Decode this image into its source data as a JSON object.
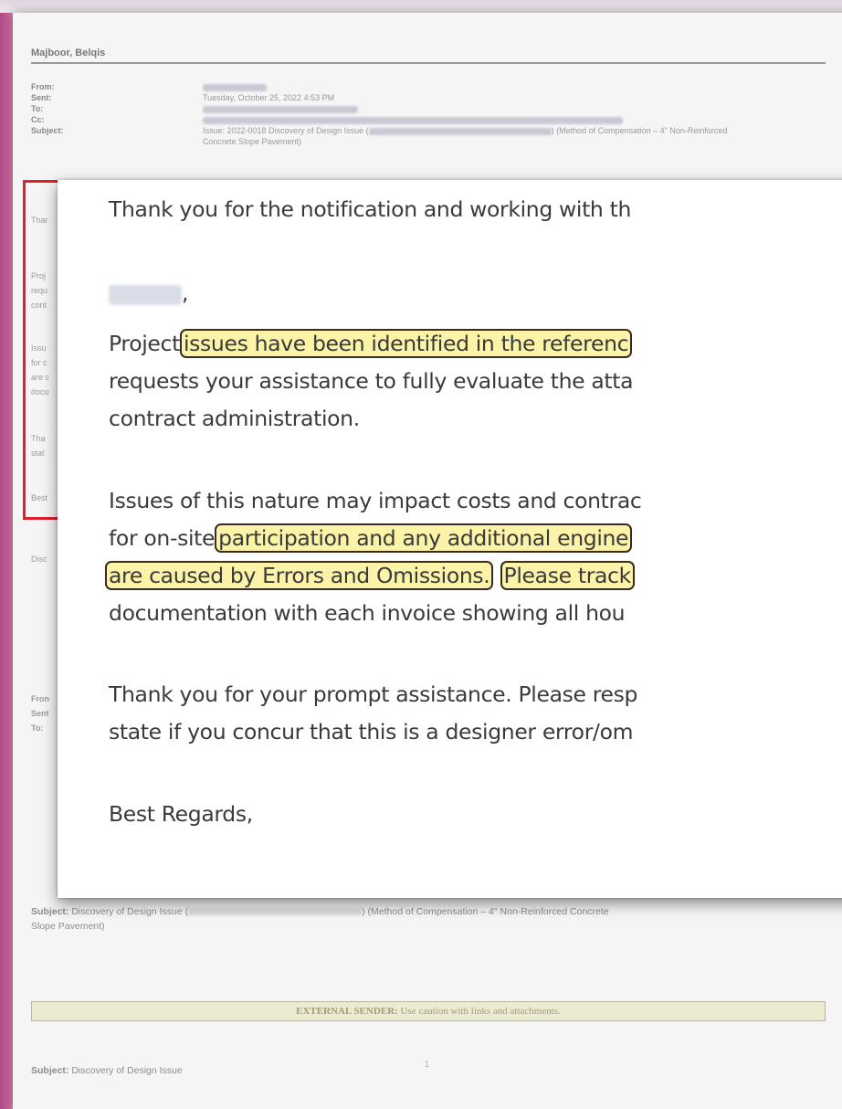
{
  "doc": {
    "author_name": "Majboor, Belqis",
    "header_labels": [
      "From:",
      "Sent:",
      "To:",
      "Cc:",
      "Subject:"
    ],
    "sent_value": "Tuesday, October 25, 2022 4:53 PM",
    "subject_value_part1": "Issue: 2022-0018 Discovery of Design Issue (",
    "subject_value_part2": ") (Method of Compensation – 4\" Non-Reinforced",
    "subject_value_line2": "Concrete Slope Pavement)",
    "left_peek": [
      "Thar",
      "Proj",
      "requ",
      "cont",
      "Issu",
      "for c",
      "are c",
      "docu",
      "Tha",
      "stat",
      "Best",
      "Disc",
      "Fron",
      "Sent",
      "To:"
    ],
    "lower_subject_label": "Subject:",
    "lower_subject_part1": "Discovery of Design Issue (",
    "lower_subject_part2": ") (Method of Compensation – 4\" Non-Reinforced Concrete",
    "lower_subject_line2": "Slope Pavement)",
    "external_label": "EXTERNAL SENDER:",
    "external_text": "Use caution with links and attachments.",
    "bottom_subject_label": "Subject:",
    "bottom_subject_value": "Discovery of Design Issue",
    "page_number": "1"
  },
  "callout": {
    "line1": "Thank you for the notification and working with th",
    "greeting_suffix": ",",
    "p1_l1_pre": "Project",
    "p1_l1_hl": "issues have been identified in the referenc",
    "p1_l2": "requests your assistance to fully evaluate the atta",
    "p1_l3": "contract administration.",
    "p2_l1": "Issues of this nature may impact costs and contrac",
    "p2_l2_pre": "for on-site",
    "p2_l2_hl": "participation and any additional engine",
    "p2_l3_hl1": "are caused by Errors and Omissions.",
    "p2_l3_hl2": "Please track",
    "p2_l4": "documentation with each invoice showing all hou",
    "p3_l1": "Thank you for your prompt assistance.  Please resp",
    "p3_l2": "state if you concur that this is a designer error/om",
    "closing": "Best Regards,"
  },
  "colors": {
    "highlight": "#fbf3a8",
    "red_box": "#e0202a",
    "frame": "#b04a86"
  }
}
